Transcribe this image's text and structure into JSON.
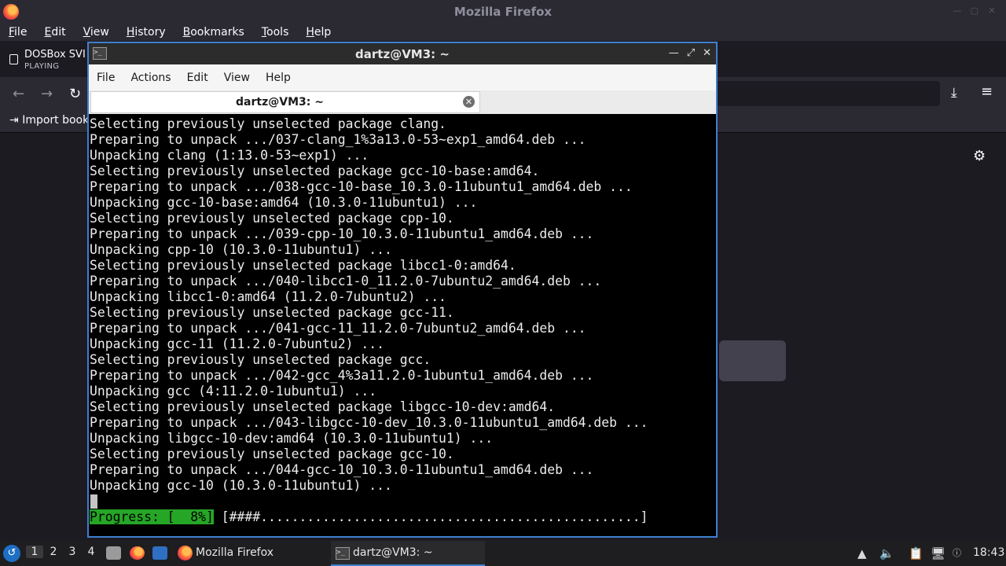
{
  "firefox": {
    "window_title": "Mozilla Firefox",
    "menu": [
      "File",
      "Edit",
      "View",
      "History",
      "Bookmarks",
      "Tools",
      "Help"
    ],
    "tab": {
      "title": "DOSBox SVI",
      "subtitle": "PLAYING"
    },
    "bookmarks_item": "Import book"
  },
  "terminal": {
    "window_title": "dartz@VM3: ~",
    "menu": [
      "File",
      "Actions",
      "Edit",
      "View",
      "Help"
    ],
    "tab_label": "dartz@VM3: ~",
    "lines": [
      "Selecting previously unselected package clang.",
      "Preparing to unpack .../037-clang_1%3a13.0-53~exp1_amd64.deb ...",
      "Unpacking clang (1:13.0-53~exp1) ...",
      "Selecting previously unselected package gcc-10-base:amd64.",
      "Preparing to unpack .../038-gcc-10-base_10.3.0-11ubuntu1_amd64.deb ...",
      "Unpacking gcc-10-base:amd64 (10.3.0-11ubuntu1) ...",
      "Selecting previously unselected package cpp-10.",
      "Preparing to unpack .../039-cpp-10_10.3.0-11ubuntu1_amd64.deb ...",
      "Unpacking cpp-10 (10.3.0-11ubuntu1) ...",
      "Selecting previously unselected package libcc1-0:amd64.",
      "Preparing to unpack .../040-libcc1-0_11.2.0-7ubuntu2_amd64.deb ...",
      "Unpacking libcc1-0:amd64 (11.2.0-7ubuntu2) ...",
      "Selecting previously unselected package gcc-11.",
      "Preparing to unpack .../041-gcc-11_11.2.0-7ubuntu2_amd64.deb ...",
      "Unpacking gcc-11 (11.2.0-7ubuntu2) ...",
      "Selecting previously unselected package gcc.",
      "Preparing to unpack .../042-gcc_4%3a11.2.0-1ubuntu1_amd64.deb ...",
      "Unpacking gcc (4:11.2.0-1ubuntu1) ...",
      "Selecting previously unselected package libgcc-10-dev:amd64.",
      "Preparing to unpack .../043-libgcc-10-dev_10.3.0-11ubuntu1_amd64.deb ...",
      "Unpacking libgcc-10-dev:amd64 (10.3.0-11ubuntu1) ...",
      "Selecting previously unselected package gcc-10.",
      "Preparing to unpack .../044-gcc-10_10.3.0-11ubuntu1_amd64.deb ...",
      "Unpacking gcc-10 (10.3.0-11ubuntu1) ..."
    ],
    "progress_label": "Progress: [  8%]",
    "progress_bar": " [####.................................................]",
    "progress_percent": 8,
    "progress_color": "#26a626"
  },
  "taskbar": {
    "workspaces": [
      "1",
      "2",
      "3",
      "4"
    ],
    "active_workspace": "1",
    "tasks": {
      "firefox": "Mozilla Firefox",
      "terminal": "dartz@VM3: ~"
    },
    "clock": "18:43"
  }
}
